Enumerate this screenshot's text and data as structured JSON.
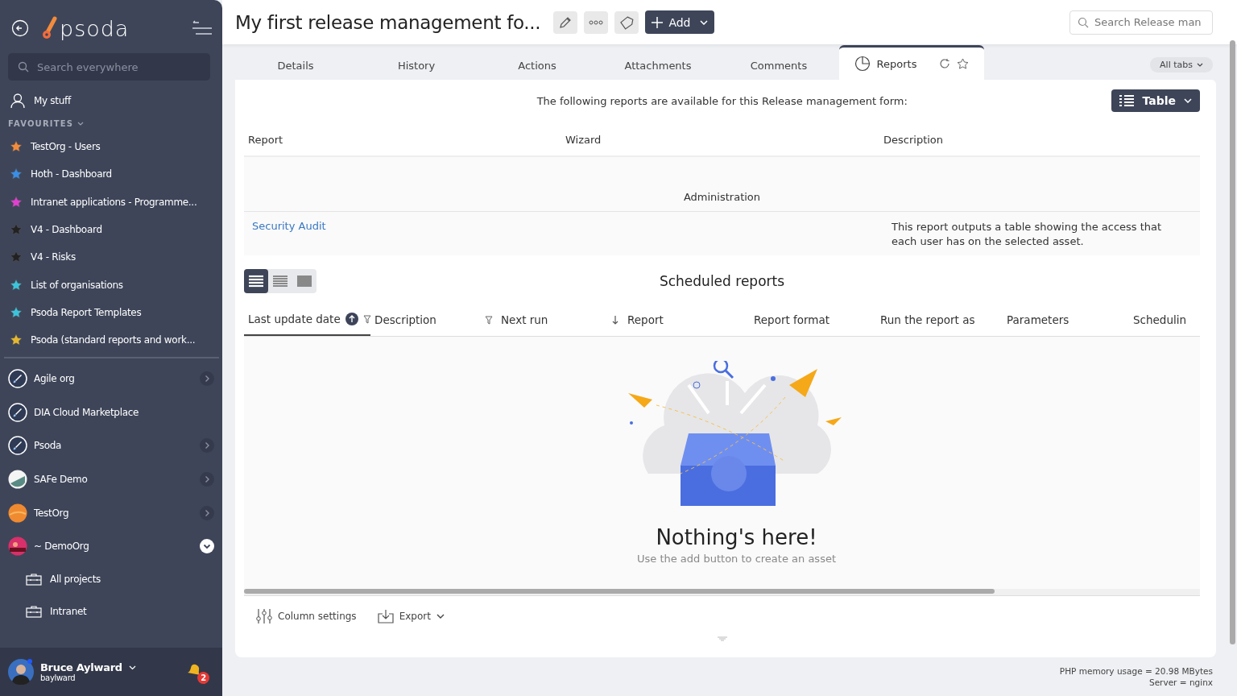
{
  "sidebar": {
    "logo": "psoda",
    "search": {
      "placeholder": "Search everywhere"
    },
    "my_stuff": "My stuff",
    "favourites_heading": "FAVOURITES",
    "favourites": [
      {
        "label": "TestOrg - Users",
        "color": "#f28c3c"
      },
      {
        "label": "Hoth - Dashboard",
        "color": "#3a8ee6"
      },
      {
        "label": "Intranet applications - Programme...",
        "color": "#e040d0"
      },
      {
        "label": "V4 - Dashboard",
        "color": "#222222"
      },
      {
        "label": "V4 - Risks",
        "color": "#222222"
      },
      {
        "label": "List of organisations",
        "color": "#3cc4dc"
      },
      {
        "label": "Psoda Report Templates",
        "color": "#3cc4dc"
      },
      {
        "label": "Psoda (standard reports and work...",
        "color": "#e6b830"
      }
    ],
    "organisations": [
      {
        "label": "Agile org",
        "kind": "rocket",
        "expanded": false
      },
      {
        "label": "DIA Cloud Marketplace",
        "kind": "rocket"
      },
      {
        "label": "Psoda",
        "kind": "rocket",
        "expanded": false
      },
      {
        "label": "SAFe Demo",
        "kind": "building",
        "expanded": false
      },
      {
        "label": "TestOrg",
        "kind": "sunset",
        "expanded": false
      },
      {
        "label": "~ DemoOrg",
        "kind": "sunrise",
        "expanded": true,
        "children": [
          {
            "label": "All projects"
          },
          {
            "label": "Intranet"
          }
        ]
      }
    ],
    "user": {
      "name": "Bruce Aylward",
      "username": "baylward",
      "notifications": "2"
    }
  },
  "header": {
    "title": "My first release management fo...",
    "add_button": "Add",
    "search": {
      "placeholder": "Search Release man"
    }
  },
  "tabs": [
    {
      "label": "Details",
      "selected": false
    },
    {
      "label": "History",
      "selected": false
    },
    {
      "label": "Actions",
      "selected": false
    },
    {
      "label": "Attachments",
      "selected": false
    },
    {
      "label": "Comments",
      "selected": false
    },
    {
      "label": "Reports",
      "selected": true
    }
  ],
  "all_tabs": "All tabs",
  "reports": {
    "intro": "The following reports are available for this Release management form:",
    "view_button": "Table",
    "columns": [
      "Report",
      "Wizard",
      "Description"
    ],
    "groups": [
      {
        "name": "Administration",
        "rows": [
          {
            "report": "Security Audit",
            "description": "This report outputs a table showing the access that each user has on the selected asset."
          }
        ]
      }
    ]
  },
  "scheduled": {
    "title": "Scheduled reports",
    "view_modes": [
      {
        "kind": "comfortable",
        "selected": true
      },
      {
        "kind": "compact",
        "selected": false
      },
      {
        "kind": "dense",
        "selected": false
      }
    ],
    "columns": [
      {
        "label": "Last update date",
        "selected": true,
        "sorted": true,
        "filter": true,
        "sort_arrow": false
      },
      {
        "label": "Description",
        "selected": false,
        "sorted": false,
        "filter": true,
        "sort_arrow": false
      },
      {
        "label": "Next run",
        "selected": false,
        "sorted": false,
        "filter": false,
        "sort_arrow": true
      },
      {
        "label": "Report",
        "selected": false,
        "sorted": false,
        "filter": false,
        "sort_arrow": false
      },
      {
        "label": "Report format",
        "selected": false,
        "sorted": false,
        "filter": false,
        "sort_arrow": false
      },
      {
        "label": "Run the report as",
        "selected": false,
        "sorted": false,
        "filter": false,
        "sort_arrow": false
      },
      {
        "label": "Parameters",
        "selected": false,
        "sorted": false,
        "filter": false,
        "sort_arrow": false
      },
      {
        "label": "Schedulin",
        "selected": false,
        "sorted": false,
        "filter": false,
        "sort_arrow": false
      }
    ],
    "empty": {
      "title": "Nothing's here!",
      "subtitle": "Use the add button to create an asset"
    },
    "column_settings": "Column settings",
    "export": "Export"
  },
  "status": [
    "PHP memory usage = 20.98 MBytes",
    "Server = nginx"
  ]
}
